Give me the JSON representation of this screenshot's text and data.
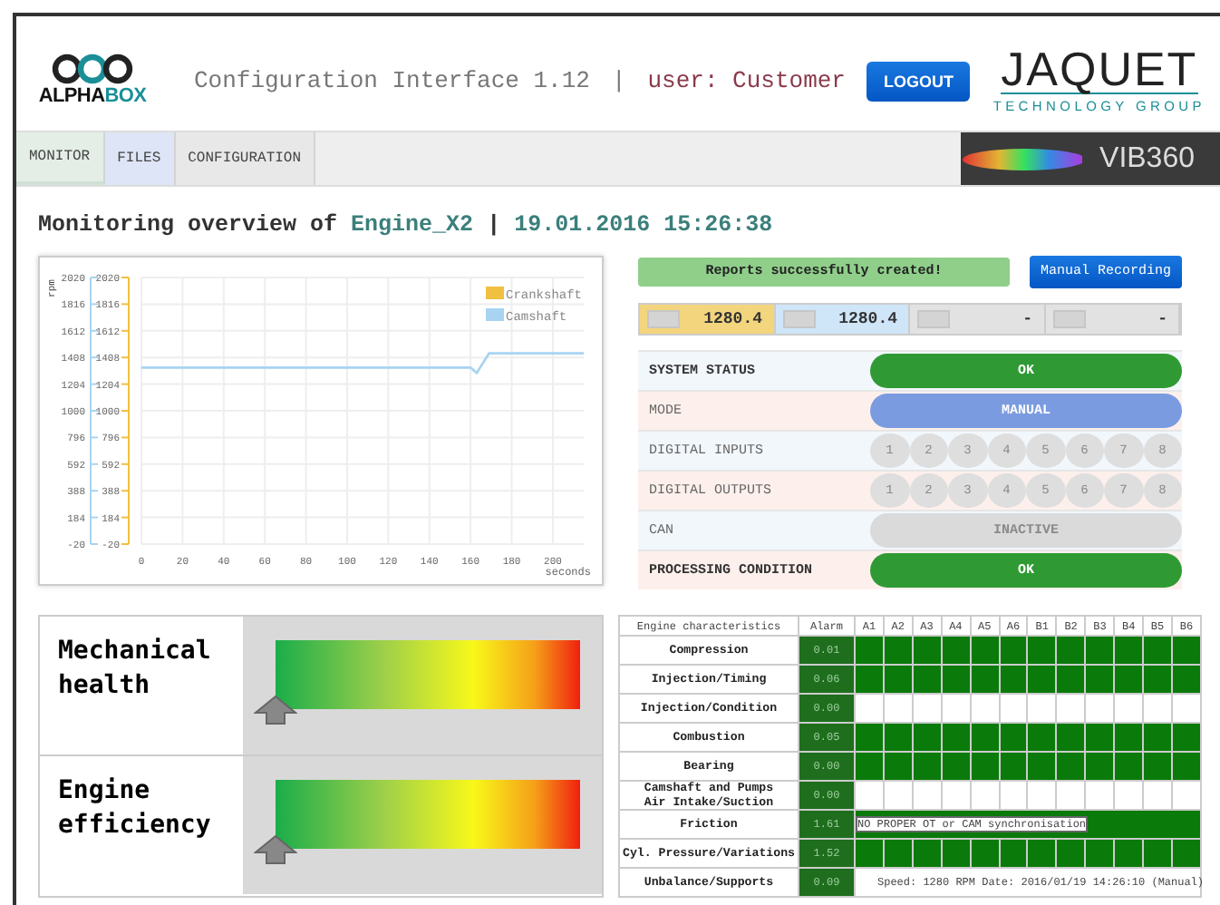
{
  "header": {
    "logo": {
      "part_a": "ALPHA",
      "part_b": "BOX"
    },
    "title": "Configuration Interface 1.12",
    "separator": "|",
    "user": "user: Customer",
    "logout": "LOGOUT",
    "partner": {
      "name": "JAQUET",
      "tagline": "TECHNOLOGY GROUP"
    }
  },
  "tabs": [
    {
      "label": "MONITOR",
      "selected": true,
      "color": "#e4eee7"
    },
    {
      "label": "FILES",
      "selected": false,
      "color": "#dde5f6"
    },
    {
      "label": "CONFIGURATION",
      "selected": false,
      "color": "#e8e8e8"
    }
  ],
  "banner": {
    "name": "VIB360"
  },
  "overview": {
    "prefix": "Monitoring overview of",
    "engine": "Engine_X2",
    "separator": "|",
    "timestamp": "19.01.2016 15:26:38"
  },
  "chart_secondary_axis": {
    "ticks": [
      "2020",
      "1816",
      "1612",
      "1408",
      "1204",
      "1000",
      "796",
      "592",
      "388",
      "184",
      "-20"
    ]
  },
  "chart_data": {
    "type": "line",
    "grid": true,
    "legend": true,
    "ylabel": "rpm",
    "xlabel": "seconds",
    "xlim": [
      0,
      215
    ],
    "ylim": [
      -20,
      2020
    ],
    "xticks": [
      0,
      20,
      40,
      60,
      80,
      100,
      120,
      140,
      160,
      180,
      200
    ],
    "yticks": [
      -20,
      184,
      388,
      592,
      796,
      1000,
      1204,
      1408,
      1612,
      1816,
      2020
    ],
    "x": [
      0,
      20,
      40,
      60,
      80,
      100,
      120,
      140,
      160,
      163,
      169,
      180,
      200,
      215
    ],
    "series": [
      {
        "name": "Crankshaft",
        "color": "#f0c040",
        "values": [
          null,
          null,
          null,
          null,
          null,
          null,
          null,
          null,
          null,
          null,
          null,
          null,
          null,
          null
        ]
      },
      {
        "name": "Camshaft",
        "color": "#a8d4f2",
        "values": [
          1330,
          1330,
          1330,
          1330,
          1330,
          1330,
          1330,
          1330,
          1330,
          1290,
          1440,
          1440,
          1440,
          1440
        ]
      }
    ]
  },
  "notice": "Reports successfully created!",
  "record_button": "Manual Recording",
  "readings": [
    {
      "value": "1280.4",
      "color": "#f3d57e"
    },
    {
      "value": "1280.4",
      "color": "#cfe5f8"
    },
    {
      "value": "-",
      "color": "#e2e2e2"
    },
    {
      "value": "-",
      "color": "#e2e2e2"
    }
  ],
  "status_rows": [
    {
      "label": "SYSTEM STATUS",
      "strong": true,
      "kind": "pill",
      "color": "#2f9a34",
      "disabled": false,
      "text": "OK"
    },
    {
      "label": "MODE",
      "strong": false,
      "kind": "pill",
      "color": "#7b9be0",
      "disabled": false,
      "text": "MANUAL"
    },
    {
      "label": "DIGITAL INPUTS",
      "strong": false,
      "kind": "channels",
      "channels": [
        {
          "label": "1",
          "on": false
        },
        {
          "label": "2",
          "on": false
        },
        {
          "label": "3",
          "on": false
        },
        {
          "label": "4",
          "on": false
        },
        {
          "label": "5",
          "on": false
        },
        {
          "label": "6",
          "on": false
        },
        {
          "label": "7",
          "on": false
        },
        {
          "label": "8",
          "on": false
        }
      ]
    },
    {
      "label": "DIGITAL OUTPUTS",
      "strong": false,
      "kind": "channels",
      "channels": [
        {
          "label": "1",
          "on": false
        },
        {
          "label": "2",
          "on": false
        },
        {
          "label": "3",
          "on": false
        },
        {
          "label": "4",
          "on": false
        },
        {
          "label": "5",
          "on": false
        },
        {
          "label": "6",
          "on": false
        },
        {
          "label": "7",
          "on": false
        },
        {
          "label": "8",
          "on": false
        }
      ]
    },
    {
      "label": "CAN",
      "strong": false,
      "kind": "pill",
      "color": "#dadada",
      "disabled": true,
      "text": "INACTIVE"
    },
    {
      "label": "PROCESSING CONDITION",
      "strong": true,
      "kind": "pill",
      "color": "#2f9a34",
      "disabled": false,
      "text": "OK"
    }
  ],
  "gauges": [
    {
      "label": "Mechanical health",
      "level": 0
    },
    {
      "label": "Engine efficiency",
      "level": 0
    }
  ],
  "engine_table": {
    "columns": [
      "Engine characteristics",
      "Alarm",
      "A1",
      "A2",
      "A3",
      "A4",
      "A5",
      "A6",
      "B1",
      "B2",
      "B3",
      "B4",
      "B5",
      "B6"
    ],
    "rows": [
      {
        "name": "Compression",
        "alarm": "0.01",
        "filled": true
      },
      {
        "name": "Injection/Timing",
        "alarm": "0.06",
        "filled": true
      },
      {
        "name": "Injection/Condition",
        "alarm": "0.00",
        "filled": false
      },
      {
        "name": "Combustion",
        "alarm": "0.05",
        "filled": true
      },
      {
        "name": "Bearing",
        "alarm": "0.00",
        "filled": true
      },
      {
        "name": "Camshaft and Pumps\nAir Intake/Suction",
        "alarm": "0.00",
        "filled": false
      },
      {
        "name": "Friction",
        "alarm": "1.61",
        "filled": true,
        "note": "NO PROPER OT or CAM synchronisation",
        "note_boxed": true
      },
      {
        "name": "Cyl. Pressure/Variations",
        "alarm": "1.52",
        "filled": true
      },
      {
        "name": "Unbalance/Supports",
        "alarm": "0.09",
        "filled": false,
        "note": "Speed: 1280 RPM  Date: 2016/01/19 14:26:10 (Manual)",
        "note_boxed": false
      }
    ]
  }
}
